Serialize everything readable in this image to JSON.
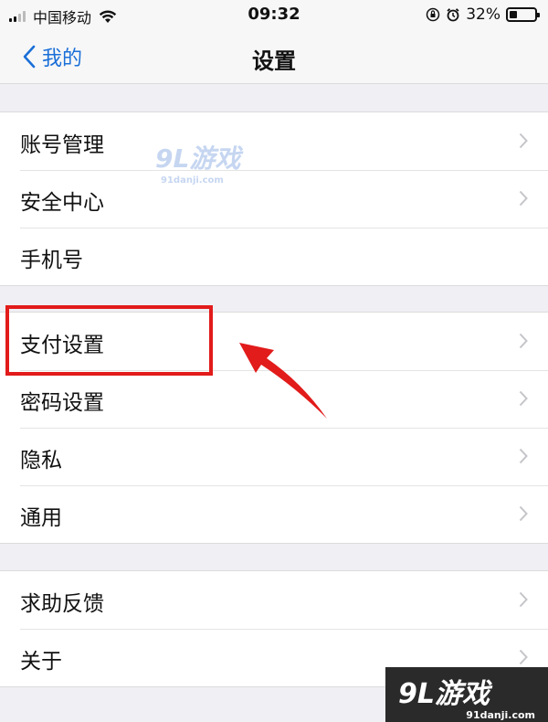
{
  "status_bar": {
    "carrier": "中国移动",
    "time": "09:32",
    "battery_percent": "32%",
    "battery_level": 0.32
  },
  "nav": {
    "back_label": "我的",
    "title": "设置"
  },
  "groups": [
    {
      "items": [
        {
          "label": "账号管理"
        },
        {
          "label": "安全中心"
        },
        {
          "label": "手机号"
        }
      ]
    },
    {
      "items": [
        {
          "label": "支付设置"
        },
        {
          "label": "密码设置"
        },
        {
          "label": "隐私"
        },
        {
          "label": "通用"
        }
      ]
    },
    {
      "items": [
        {
          "label": "求助反馈"
        },
        {
          "label": "关于"
        }
      ]
    }
  ],
  "annotation": {
    "color": "#e21b1b",
    "highlighted_item": "支付设置"
  },
  "watermark": {
    "brand": "9L游戏",
    "domain": "91danji.com"
  },
  "colors": {
    "accent": "#1a6fd8",
    "background": "#efeff4"
  }
}
